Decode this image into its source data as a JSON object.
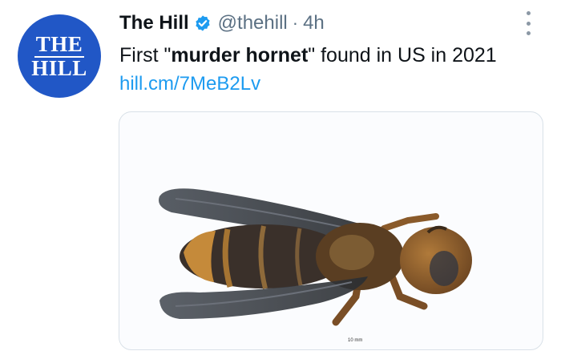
{
  "account": {
    "avatar_line1": "THE",
    "avatar_line2": "HILL",
    "display_name": "The Hill",
    "handle": "@thehill",
    "separator": "·",
    "timestamp": "4h",
    "verified": true
  },
  "tweet": {
    "text_before": "First \"",
    "text_bold": "murder hornet",
    "text_after": "\" found in US in 2021",
    "link": "hill.cm/7MeB2Lv"
  },
  "media": {
    "scale_label": "10 mm",
    "subject": "dead-hornet-photo"
  },
  "colors": {
    "avatar_bg": "#2157c6",
    "link": "#1d9bf0",
    "verified": "#1d9bf0",
    "muted": "#5b7083"
  }
}
